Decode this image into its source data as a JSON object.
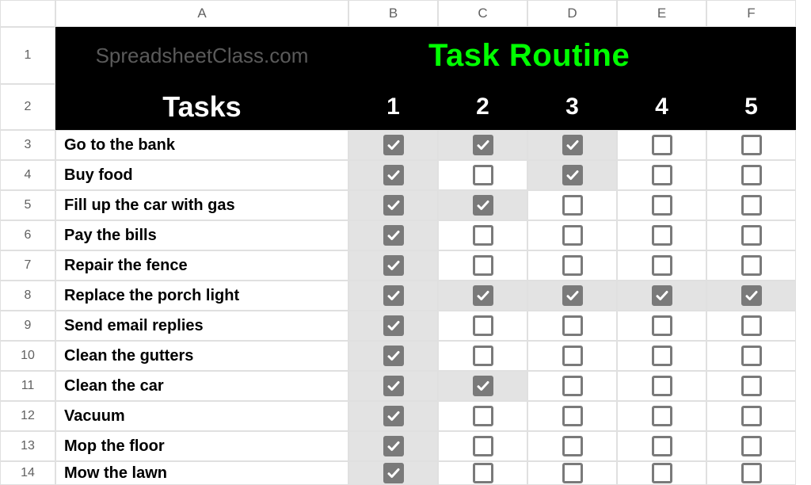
{
  "columns": [
    "A",
    "B",
    "C",
    "D",
    "E",
    "F"
  ],
  "rowNumbers": [
    1,
    2,
    3,
    4,
    5,
    6,
    7,
    8,
    9,
    10,
    11,
    12,
    13,
    14
  ],
  "header1": {
    "left": "SpreadsheetClass.com",
    "right": "Task Routine"
  },
  "header2": {
    "tasks": "Tasks",
    "nums": [
      "1",
      "2",
      "3",
      "4",
      "5"
    ]
  },
  "tasks": [
    {
      "label": "Go to the bank",
      "checks": [
        true,
        true,
        true,
        false,
        false
      ],
      "shaded": [
        true,
        true,
        true,
        false,
        false
      ]
    },
    {
      "label": "Buy food",
      "checks": [
        true,
        false,
        true,
        false,
        false
      ],
      "shaded": [
        true,
        false,
        true,
        false,
        false
      ]
    },
    {
      "label": "Fill up the car with gas",
      "checks": [
        true,
        true,
        false,
        false,
        false
      ],
      "shaded": [
        true,
        true,
        false,
        false,
        false
      ]
    },
    {
      "label": "Pay the bills",
      "checks": [
        true,
        false,
        false,
        false,
        false
      ],
      "shaded": [
        true,
        false,
        false,
        false,
        false
      ]
    },
    {
      "label": "Repair the fence",
      "checks": [
        true,
        false,
        false,
        false,
        false
      ],
      "shaded": [
        true,
        false,
        false,
        false,
        false
      ]
    },
    {
      "label": "Replace the porch light",
      "checks": [
        true,
        true,
        true,
        true,
        true
      ],
      "shaded": [
        true,
        true,
        true,
        true,
        true
      ]
    },
    {
      "label": "Send email replies",
      "checks": [
        true,
        false,
        false,
        false,
        false
      ],
      "shaded": [
        true,
        false,
        false,
        false,
        false
      ]
    },
    {
      "label": "Clean the gutters",
      "checks": [
        true,
        false,
        false,
        false,
        false
      ],
      "shaded": [
        true,
        false,
        false,
        false,
        false
      ]
    },
    {
      "label": "Clean the car",
      "checks": [
        true,
        true,
        false,
        false,
        false
      ],
      "shaded": [
        true,
        true,
        false,
        false,
        false
      ]
    },
    {
      "label": "Vacuum",
      "checks": [
        true,
        false,
        false,
        false,
        false
      ],
      "shaded": [
        true,
        false,
        false,
        false,
        false
      ]
    },
    {
      "label": "Mop the floor",
      "checks": [
        true,
        false,
        false,
        false,
        false
      ],
      "shaded": [
        true,
        false,
        false,
        false,
        false
      ]
    },
    {
      "label": "Mow the lawn",
      "checks": [
        true,
        false,
        false,
        false,
        false
      ],
      "shaded": [
        true,
        false,
        false,
        false,
        false
      ]
    }
  ]
}
